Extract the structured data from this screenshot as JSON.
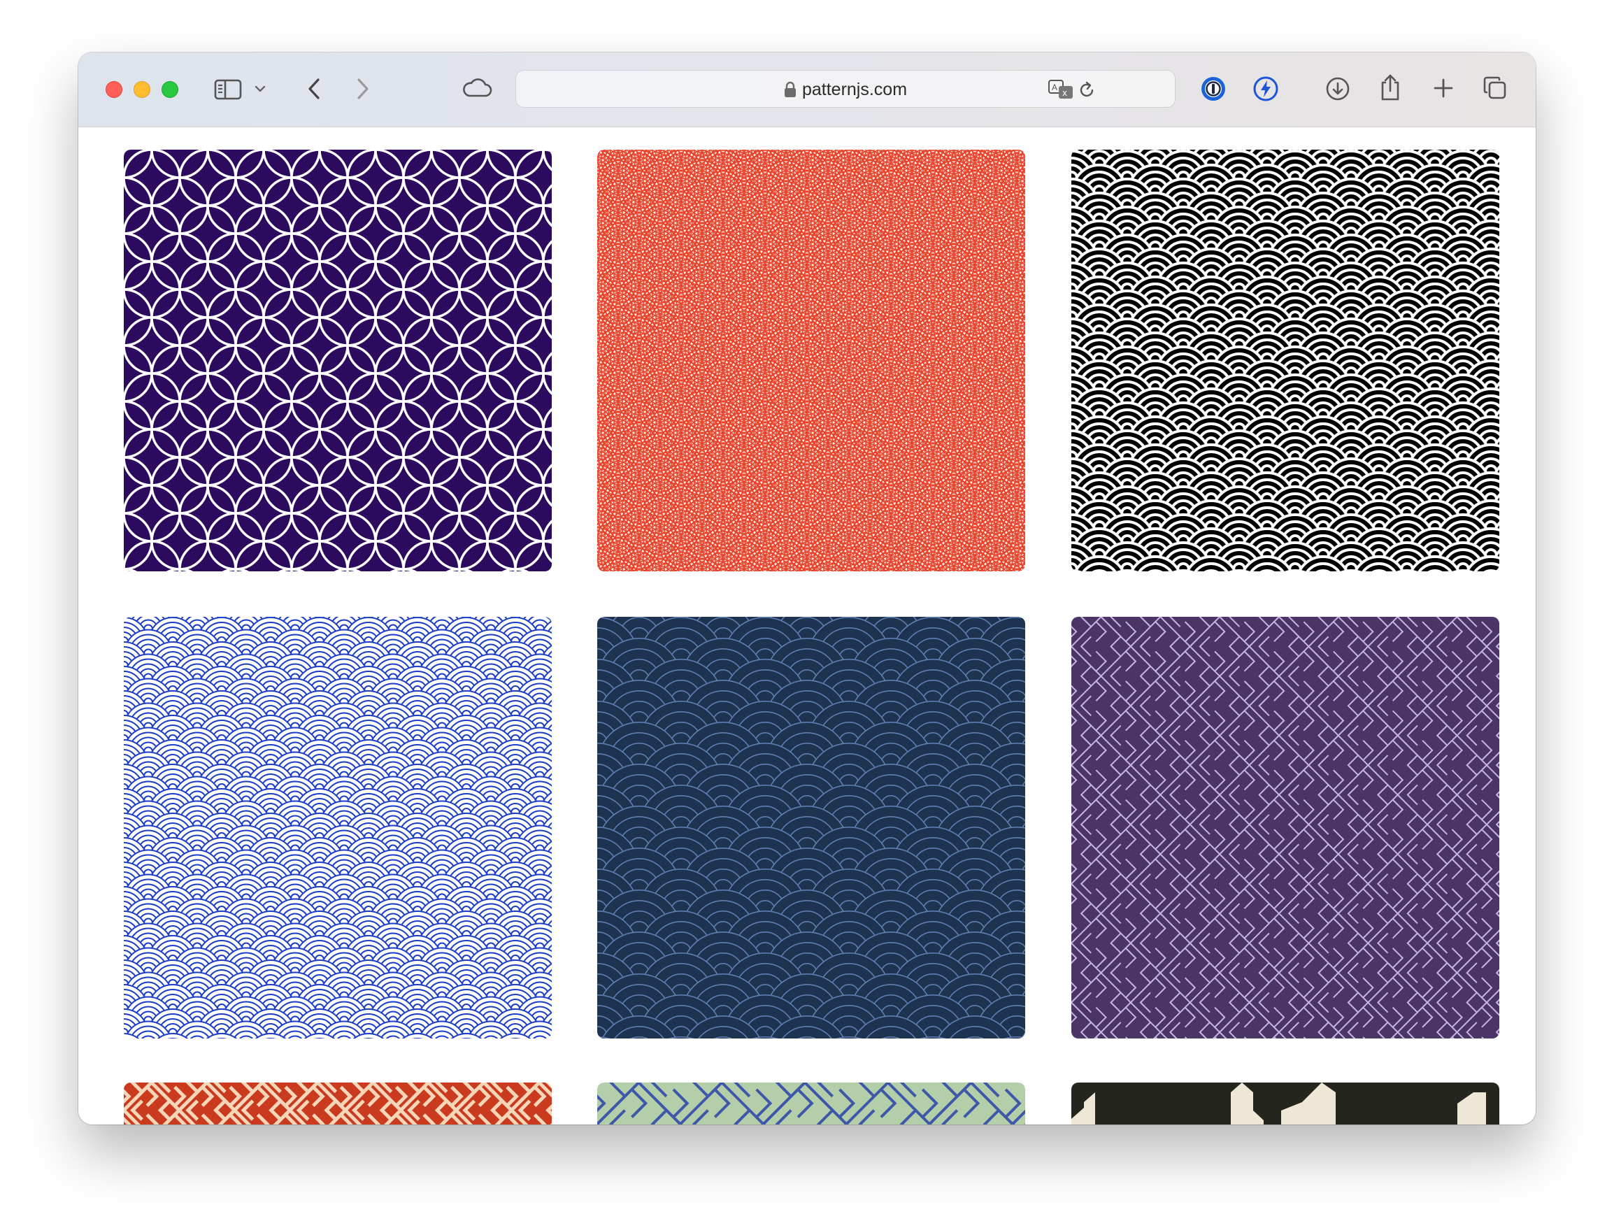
{
  "browser": {
    "url": "patternjs.com",
    "icons": [
      "sidebar-icon",
      "chevron-down-icon",
      "back-icon",
      "forward-icon",
      "icloud-icon",
      "lock-icon",
      "translate-icon",
      "reload-icon",
      "onepassword-icon",
      "bolt-extension-icon",
      "download-icon",
      "share-icon",
      "new-tab-icon",
      "tab-overview-icon"
    ]
  },
  "patterns": [
    {
      "name": "shippo",
      "bg": "#2c0a5e",
      "fg": "#ffffff"
    },
    {
      "name": "seigaiha-thin",
      "bg": "#fdebe4",
      "fg": "#e8412a"
    },
    {
      "name": "seigaiha-bold",
      "bg": "#000000",
      "fg": "#ffffff"
    },
    {
      "name": "seigaiha-blue",
      "bg": "#ffffff",
      "fg": "#1b3cc7"
    },
    {
      "name": "seigaiha-navy",
      "bg": "#1d3350",
      "fg": "#5e7eb0"
    },
    {
      "name": "sayagata-purple",
      "bg": "#4b3567",
      "fg": "#c6b6e0"
    },
    {
      "name": "sayagata-red",
      "bg": "#c93a1e",
      "fg": "#f6d6b8"
    },
    {
      "name": "sayagata-green",
      "bg": "#b3cea8",
      "fg": "#3f57a8"
    },
    {
      "name": "matsukawabishi",
      "bg": "#25251f",
      "fg": "#efe7d6"
    }
  ]
}
